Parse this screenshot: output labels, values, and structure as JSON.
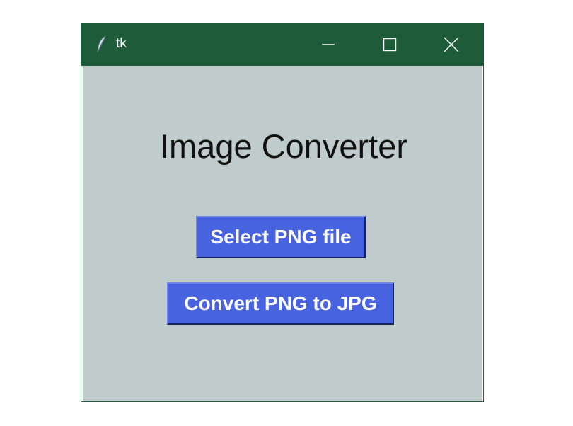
{
  "window": {
    "title": "tk",
    "icons": {
      "app": "feather-icon",
      "minimize": "minimize-icon",
      "maximize": "maximize-icon",
      "close": "close-icon"
    },
    "colors": {
      "titlebar": "#1e5b38",
      "body": "#c0cccb"
    }
  },
  "main": {
    "heading": "Image Converter",
    "select_button_label": "Select PNG file",
    "convert_button_label": "Convert PNG to JPG",
    "button_color": "#4863e0"
  }
}
